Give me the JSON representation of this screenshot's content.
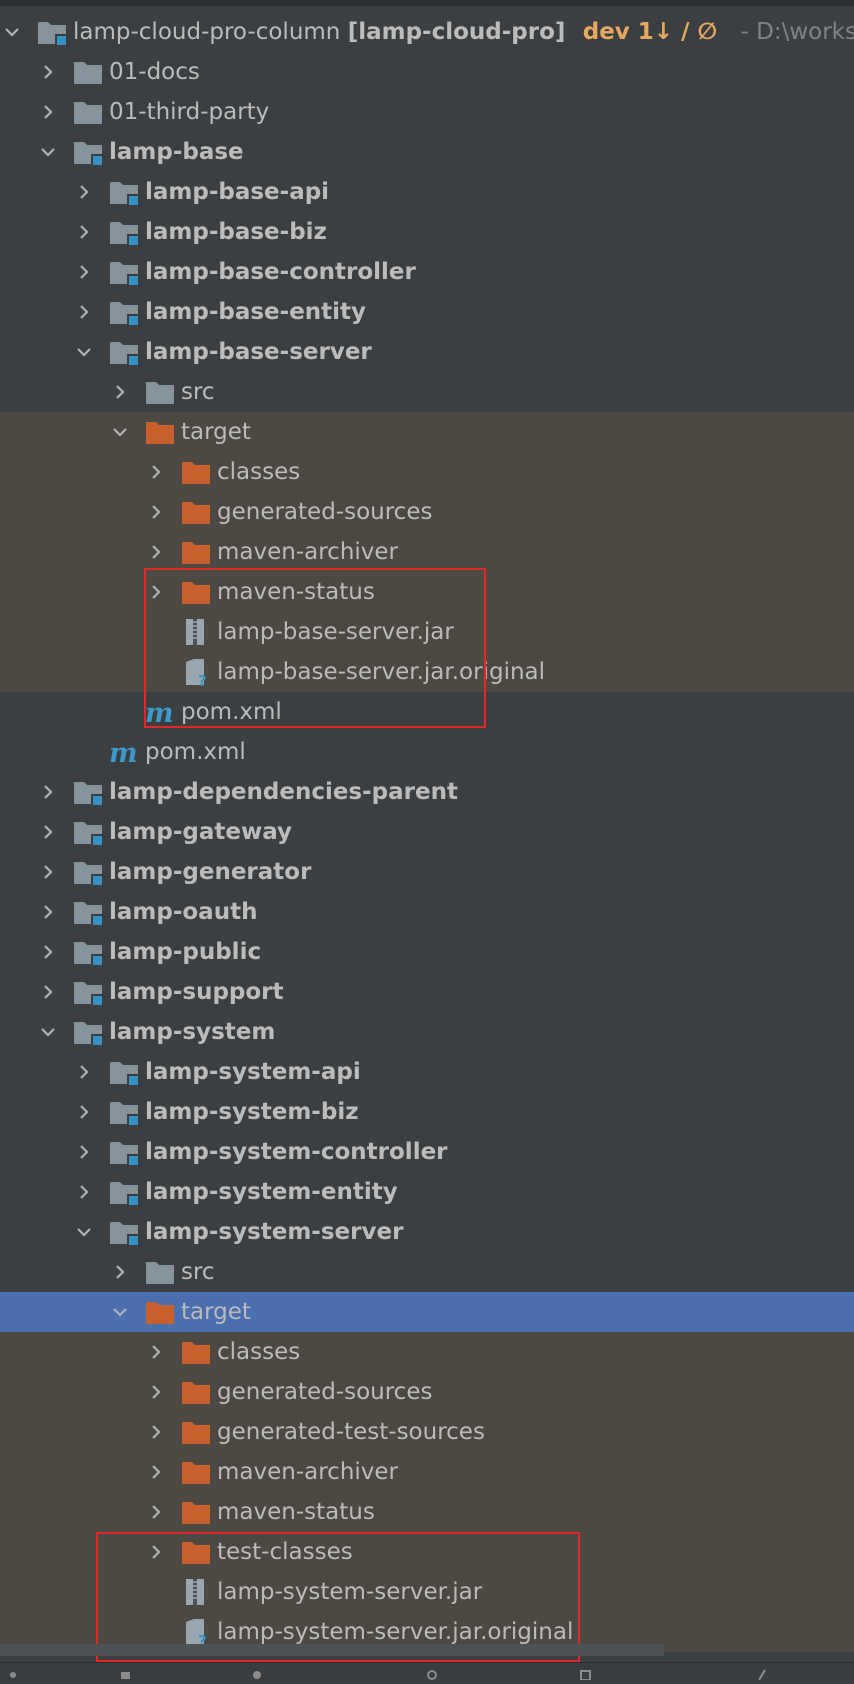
{
  "root": {
    "name": "lamp-cloud-pro-column",
    "module": "[lamp-cloud-pro]",
    "vcs": "dev 1↓ / ∅",
    "path": "- D:\\worksp"
  },
  "rows": [
    {
      "label": "01-docs",
      "indent": 1,
      "chevron": "right",
      "icon": "folder-icon",
      "bold": false,
      "state": ""
    },
    {
      "label": "01-third-party",
      "indent": 1,
      "chevron": "right",
      "icon": "folder-icon",
      "bold": false,
      "state": ""
    },
    {
      "label": "lamp-base",
      "indent": 1,
      "chevron": "down",
      "icon": "module-folder-icon",
      "bold": true,
      "state": ""
    },
    {
      "label": "lamp-base-api",
      "indent": 2,
      "chevron": "right",
      "icon": "module-folder-icon",
      "bold": true,
      "state": ""
    },
    {
      "label": "lamp-base-biz",
      "indent": 2,
      "chevron": "right",
      "icon": "module-folder-icon",
      "bold": true,
      "state": ""
    },
    {
      "label": "lamp-base-controller",
      "indent": 2,
      "chevron": "right",
      "icon": "module-folder-icon",
      "bold": true,
      "state": ""
    },
    {
      "label": "lamp-base-entity",
      "indent": 2,
      "chevron": "right",
      "icon": "module-folder-icon",
      "bold": true,
      "state": ""
    },
    {
      "label": "lamp-base-server",
      "indent": 2,
      "chevron": "down",
      "icon": "module-folder-icon",
      "bold": true,
      "state": ""
    },
    {
      "label": "src",
      "indent": 3,
      "chevron": "right",
      "icon": "folder-icon",
      "bold": false,
      "state": ""
    },
    {
      "label": "target",
      "indent": 3,
      "chevron": "down",
      "icon": "excluded-folder-icon",
      "bold": false,
      "state": "excluded"
    },
    {
      "label": "classes",
      "indent": 4,
      "chevron": "right",
      "icon": "excluded-folder-icon",
      "bold": false,
      "state": "excluded"
    },
    {
      "label": "generated-sources",
      "indent": 4,
      "chevron": "right",
      "icon": "excluded-folder-icon",
      "bold": false,
      "state": "excluded"
    },
    {
      "label": "maven-archiver",
      "indent": 4,
      "chevron": "right",
      "icon": "excluded-folder-icon",
      "bold": false,
      "state": "excluded"
    },
    {
      "label": "maven-status",
      "indent": 4,
      "chevron": "right",
      "icon": "excluded-folder-icon",
      "bold": false,
      "state": "excluded"
    },
    {
      "label": "lamp-base-server.jar",
      "indent": 4,
      "chevron": "none",
      "icon": "jar-file-icon",
      "bold": false,
      "state": "excluded"
    },
    {
      "label": "lamp-base-server.jar.original",
      "indent": 4,
      "chevron": "none",
      "icon": "unknown-file-icon",
      "bold": false,
      "state": "excluded"
    },
    {
      "label": "pom.xml",
      "indent": 3,
      "chevron": "none",
      "icon": "maven-pom-icon",
      "bold": false,
      "state": ""
    },
    {
      "label": "pom.xml",
      "indent": 2,
      "chevron": "none",
      "icon": "maven-pom-icon",
      "bold": false,
      "state": ""
    },
    {
      "label": "lamp-dependencies-parent",
      "indent": 1,
      "chevron": "right",
      "icon": "module-folder-icon",
      "bold": true,
      "state": ""
    },
    {
      "label": "lamp-gateway",
      "indent": 1,
      "chevron": "right",
      "icon": "module-folder-icon",
      "bold": true,
      "state": ""
    },
    {
      "label": "lamp-generator",
      "indent": 1,
      "chevron": "right",
      "icon": "module-folder-icon",
      "bold": true,
      "state": ""
    },
    {
      "label": "lamp-oauth",
      "indent": 1,
      "chevron": "right",
      "icon": "module-folder-icon",
      "bold": true,
      "state": ""
    },
    {
      "label": "lamp-public",
      "indent": 1,
      "chevron": "right",
      "icon": "module-folder-icon",
      "bold": true,
      "state": ""
    },
    {
      "label": "lamp-support",
      "indent": 1,
      "chevron": "right",
      "icon": "module-folder-icon",
      "bold": true,
      "state": ""
    },
    {
      "label": "lamp-system",
      "indent": 1,
      "chevron": "down",
      "icon": "module-folder-icon",
      "bold": true,
      "state": ""
    },
    {
      "label": "lamp-system-api",
      "indent": 2,
      "chevron": "right",
      "icon": "module-folder-icon",
      "bold": true,
      "state": ""
    },
    {
      "label": "lamp-system-biz",
      "indent": 2,
      "chevron": "right",
      "icon": "module-folder-icon",
      "bold": true,
      "state": ""
    },
    {
      "label": "lamp-system-controller",
      "indent": 2,
      "chevron": "right",
      "icon": "module-folder-icon",
      "bold": true,
      "state": ""
    },
    {
      "label": "lamp-system-entity",
      "indent": 2,
      "chevron": "right",
      "icon": "module-folder-icon",
      "bold": true,
      "state": ""
    },
    {
      "label": "lamp-system-server",
      "indent": 2,
      "chevron": "down",
      "icon": "module-folder-icon",
      "bold": true,
      "state": ""
    },
    {
      "label": "src",
      "indent": 3,
      "chevron": "right",
      "icon": "folder-icon",
      "bold": false,
      "state": ""
    },
    {
      "label": "target",
      "indent": 3,
      "chevron": "down",
      "icon": "excluded-folder-icon",
      "bold": false,
      "state": "selected"
    },
    {
      "label": "classes",
      "indent": 4,
      "chevron": "right",
      "icon": "excluded-folder-icon",
      "bold": false,
      "state": "excluded"
    },
    {
      "label": "generated-sources",
      "indent": 4,
      "chevron": "right",
      "icon": "excluded-folder-icon",
      "bold": false,
      "state": "excluded"
    },
    {
      "label": "generated-test-sources",
      "indent": 4,
      "chevron": "right",
      "icon": "excluded-folder-icon",
      "bold": false,
      "state": "excluded"
    },
    {
      "label": "maven-archiver",
      "indent": 4,
      "chevron": "right",
      "icon": "excluded-folder-icon",
      "bold": false,
      "state": "excluded"
    },
    {
      "label": "maven-status",
      "indent": 4,
      "chevron": "right",
      "icon": "excluded-folder-icon",
      "bold": false,
      "state": "excluded"
    },
    {
      "label": "test-classes",
      "indent": 4,
      "chevron": "right",
      "icon": "excluded-folder-icon",
      "bold": false,
      "state": "excluded"
    },
    {
      "label": "lamp-system-server.jar",
      "indent": 4,
      "chevron": "none",
      "icon": "jar-file-icon",
      "bold": false,
      "state": "excluded"
    },
    {
      "label": "lamp-system-server.jar.original",
      "indent": 4,
      "chevron": "none",
      "icon": "unknown-file-icon",
      "bold": false,
      "state": "excluded"
    }
  ],
  "colors": {
    "background": "#3c3f41",
    "excluded_background": "#4b4941",
    "selected_background": "#4b6eaf",
    "excluded_folder": "#c8602d",
    "folder": "#87939a",
    "module_marker": "#3592c4",
    "vcs_branch": "#e5a85f",
    "highlight_box": "#e0282b"
  }
}
